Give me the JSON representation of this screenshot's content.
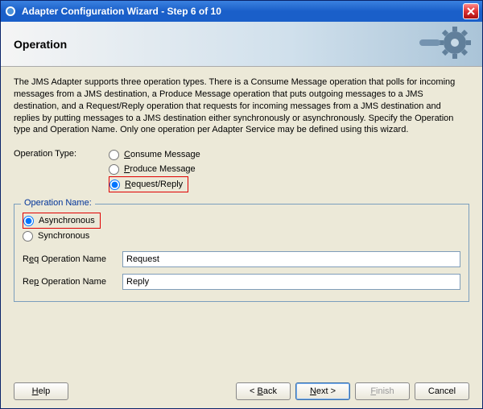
{
  "window": {
    "title": "Adapter Configuration Wizard - Step 6 of 10"
  },
  "header": {
    "title": "Operation"
  },
  "description": "The JMS Adapter supports three operation types.  There is a Consume Message operation that polls for incoming messages from a JMS destination, a Produce Message operation that puts outgoing messages to a JMS destination, and a Request/Reply operation that requests for incoming messages from a JMS destination and replies by putting messages to a JMS destination either synchronously or asynchronously.  Specify the Operation type and Operation Name.  Only one operation per Adapter Service may be defined using this wizard.",
  "operationType": {
    "label": "Operation Type:",
    "options": {
      "consume": "Consume Message",
      "produce": "Produce Message",
      "requestReply": "Request/Reply"
    },
    "selected": "requestReply"
  },
  "operationName": {
    "legend": "Operation Name:",
    "modes": {
      "async": "Asynchronous",
      "sync": "Synchronous"
    },
    "selectedMode": "async",
    "reqLabel": "Req Operation Name",
    "reqValue": "Request",
    "repLabel": "Rep Operation Name",
    "repValue": "Reply"
  },
  "buttons": {
    "help": "Help",
    "back": "< Back",
    "next": "Next >",
    "finish": "Finish",
    "cancel": "Cancel"
  }
}
